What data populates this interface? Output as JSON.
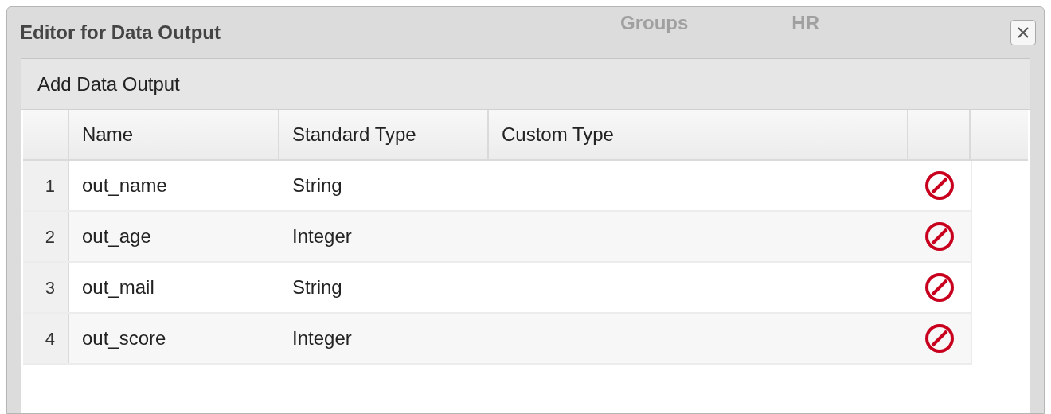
{
  "background": {
    "texts": [
      "Groups",
      "HR"
    ]
  },
  "window": {
    "title": "Editor for Data Output"
  },
  "panel": {
    "title": "Add Data Output"
  },
  "table": {
    "columns": [
      "Name",
      "Standard Type",
      "Custom Type"
    ],
    "rows": [
      {
        "number": "1",
        "name": "out_name",
        "standard_type": "String"
      },
      {
        "number": "2",
        "name": "out_age",
        "standard_type": "Integer"
      },
      {
        "number": "3",
        "name": "out_mail",
        "standard_type": "String"
      },
      {
        "number": "4",
        "name": "out_score",
        "standard_type": "Integer"
      }
    ]
  }
}
